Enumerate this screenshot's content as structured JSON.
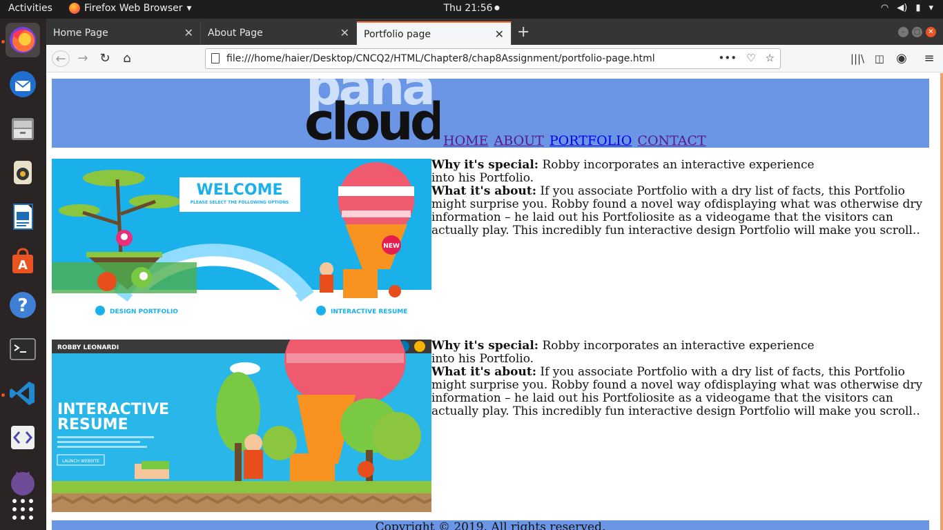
{
  "topbar": {
    "activities": "Activities",
    "app_name": "Firefox Web Browser",
    "clock": "Thu 21:56"
  },
  "dock": {
    "apps": [
      "firefox-icon",
      "thunderbird-icon",
      "files-icon",
      "rhythmbox-icon",
      "writer-icon",
      "software-icon",
      "help-icon",
      "terminal-icon",
      "vscode-icon",
      "code-editor-icon",
      "github-icon",
      "app-grid-icon"
    ]
  },
  "tabs": [
    {
      "label": "Home Page"
    },
    {
      "label": "About Page"
    },
    {
      "label": "Portfolio page"
    }
  ],
  "url": "file:///home/haier/Desktop/CNCQ2/HTML/Chapter8/chap8Assignment/portfolio-page.html",
  "logo": {
    "top": "pana",
    "bottom": "cloud"
  },
  "nav": {
    "home": "HOME",
    "about": "ABOUT",
    "portfolio": "PORTFOLIO",
    "contact": "CONTACT"
  },
  "projects": [
    {
      "special_label": "Why it's special:",
      "special_text": " Robby incorporates an interactive experience into his Portfolio.",
      "about_label": "What it's about:",
      "about_text": " If you associate Portfolio with a dry list of facts, this Portfolio might surprise you. Robby found a novel way ofdisplaying what was otherwise dry information – he laid out his Portfoliosite as a videogame that the visitors can actually play. This incredibly fun interactive design Portfolio will make you scroll..",
      "image": {
        "banner": "WELCOME",
        "sub": "PLEASE SELECT THE FOLLOWING OPTIONS",
        "opt1": "DESIGN PORTFOLIO",
        "opt2": "INTERACTIVE RESUME",
        "badge": "NEW"
      }
    },
    {
      "special_label": "Why it's special:",
      "special_text": " Robby incorporates an interactive experience into his Portfolio.",
      "about_label": "What it's about:",
      "about_text": " If you associate Portfolio with a dry list of facts, this Portfolio might surprise you. Robby found a novel way ofdisplaying what was otherwise dry information – he laid out his Portfoliosite as a videogame that the visitors can actually play. This incredibly fun interactive design Portfolio will make you scroll..",
      "image": {
        "name": "ROBBY LEONARDI",
        "title1": "INTERACTIVE",
        "title2": "RESUME",
        "button": "LAUNCH WEBSITE"
      }
    }
  ],
  "footer": "Copyright © 2019. All rights reserved.",
  "colors": {
    "header": "#6a96e5",
    "tab_accent": "#ff7139",
    "sky": "#1ab0ea"
  }
}
